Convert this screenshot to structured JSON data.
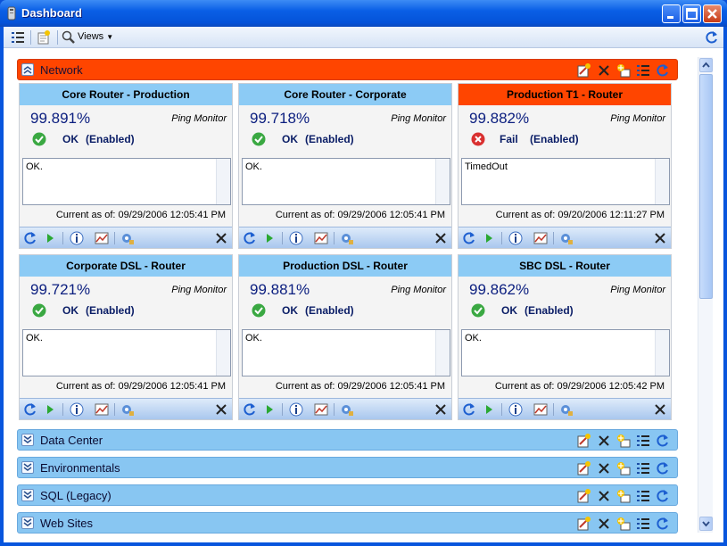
{
  "window": {
    "title": "Dashboard"
  },
  "toolbar": {
    "views_label": "Views"
  },
  "groups": [
    {
      "title": "Network",
      "expanded": true,
      "color": "#ff4500",
      "cards": [
        {
          "name": "Core Router - Production",
          "percent": "99.891%",
          "monitor": "Ping Monitor",
          "status": "OK",
          "state": "(Enabled)",
          "message": "OK.",
          "as_of": "Current as of: 09/29/2006 12:05:41 PM",
          "alert": false
        },
        {
          "name": "Core Router - Corporate",
          "percent": "99.718%",
          "monitor": "Ping Monitor",
          "status": "OK",
          "state": "(Enabled)",
          "message": "OK.",
          "as_of": "Current as of: 09/29/2006 12:05:41 PM",
          "alert": false
        },
        {
          "name": "Production T1 - Router",
          "percent": "99.882%",
          "monitor": "Ping Monitor",
          "status": "Fail",
          "state": "(Enabled)",
          "message": "TimedOut",
          "as_of": "Current as of: 09/20/2006 12:11:27 PM",
          "alert": true
        },
        {
          "name": "Corporate DSL - Router",
          "percent": "99.721%",
          "monitor": "Ping Monitor",
          "status": "OK",
          "state": "(Enabled)",
          "message": "OK.",
          "as_of": "Current as of: 09/29/2006 12:05:41 PM",
          "alert": false
        },
        {
          "name": "Production DSL - Router",
          "percent": "99.881%",
          "monitor": "Ping Monitor",
          "status": "OK",
          "state": "(Enabled)",
          "message": "OK.",
          "as_of": "Current as of: 09/29/2006 12:05:41 PM",
          "alert": false
        },
        {
          "name": "SBC DSL - Router",
          "percent": "99.862%",
          "monitor": "Ping Monitor",
          "status": "OK",
          "state": "(Enabled)",
          "message": "OK.",
          "as_of": "Current as of: 09/29/2006 12:05:42 PM",
          "alert": false
        }
      ]
    },
    {
      "title": "Data Center",
      "expanded": false,
      "color": "#88c6f2"
    },
    {
      "title": "Environmentals",
      "expanded": false,
      "color": "#88c6f2"
    },
    {
      "title": "SQL (Legacy)",
      "expanded": false,
      "color": "#88c6f2"
    },
    {
      "title": "Web Sites",
      "expanded": false,
      "color": "#88c6f2"
    }
  ],
  "colors": {
    "ok": "#3aa842",
    "fail": "#d93030",
    "alert_header": "#ff4500",
    "card_header": "#8ccbf5"
  },
  "icons": {
    "group_tools": [
      "edit-icon",
      "delete-icon",
      "add-monitor-icon",
      "list-icon",
      "refresh-icon"
    ],
    "card_tools": [
      "refresh-icon",
      "play-icon",
      "info-icon",
      "chart-icon",
      "settings-icon",
      "close-icon"
    ]
  }
}
